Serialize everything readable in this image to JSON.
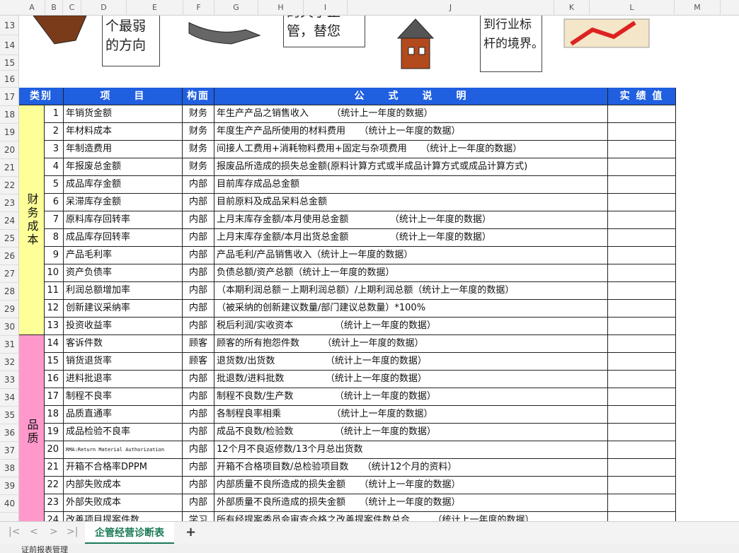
{
  "columns": [
    "A",
    "B",
    "C",
    "D",
    "E",
    "F",
    "G",
    "H",
    "I",
    "J",
    "K",
    "L",
    "M"
  ],
  "rows": [
    "13",
    "14",
    "15",
    "16",
    "17",
    "18",
    "19",
    "20",
    "21",
    "22",
    "23",
    "24",
    "25",
    "26",
    "27",
    "28",
    "29",
    "30",
    "31",
    "32",
    "33",
    "34",
    "35",
    "36",
    "37",
    "38",
    "39",
    "40"
  ],
  "bubbles": {
    "b1": "个最弱\n的方向",
    "b2": "的天子止\n管，替您",
    "b3": "到行业标\n杆的境界。"
  },
  "header": {
    "category": "类别",
    "item": "项　　目",
    "dimension": "构面",
    "formula": "公　　式　　说　　明",
    "actual": "实 绩 值"
  },
  "categories": {
    "finance": "财务成本",
    "quality": "品质"
  },
  "table_rows": [
    {
      "no": "1",
      "item": "年销货金额",
      "dim": "财务",
      "formula": "年生产产品之销售收入　　　（统计上一年度的数据）"
    },
    {
      "no": "2",
      "item": "年材料成本",
      "dim": "财务",
      "formula": "年度生产产品所使用的材料费用　　（统计上一年度的数据）"
    },
    {
      "no": "3",
      "item": "年制造费用",
      "dim": "财务",
      "formula": "间接人工费用+消耗物料费用+固定与杂项费用　　（统计上一年度的数据）"
    },
    {
      "no": "4",
      "item": "年报废总金额",
      "dim": "财务",
      "formula": "报废品所造成的损失总金额(原料计算方式或半成品计算方式或成品计算方式)"
    },
    {
      "no": "5",
      "item": "成品库存金额",
      "dim": "内部",
      "formula": "目前库存成品总金额"
    },
    {
      "no": "6",
      "item": "呆滞库存金额",
      "dim": "内部",
      "formula": "目前原料及成品呆料总金额"
    },
    {
      "no": "7",
      "item": "原料库存回转率",
      "dim": "内部",
      "formula": "上月末库存金额/本月使用总金额　　　　　（统计上一年度的数据）"
    },
    {
      "no": "8",
      "item": "成品库存回转率",
      "dim": "内部",
      "formula": "上月末库存金额/本月出货总金额　　　　　（统计上一年度的数据）"
    },
    {
      "no": "9",
      "item": "产品毛利率",
      "dim": "内部",
      "formula": "产品毛利/产品销售收入（统计上一年度的数据）"
    },
    {
      "no": "10",
      "item": "资产负债率",
      "dim": "内部",
      "formula": "负债总额/资产总额（统计上一年度的数据）"
    },
    {
      "no": "11",
      "item": "利润总额增加率",
      "dim": "内部",
      "formula": "（本期利润总额－上期利润总额）/上期利润总额（统计上一年度的数据）"
    },
    {
      "no": "12",
      "item": "创新建议采纳率",
      "dim": "内部",
      "formula": "（被采纳的创新建议数量/部门建议总数量）*100%"
    },
    {
      "no": "13",
      "item": "投资收益率",
      "dim": "内部",
      "formula": "税后利润/实收资本　　　　　（统计上一年度的数据）"
    },
    {
      "no": "14",
      "item": "客诉件数",
      "dim": "顾客",
      "formula": "顾客的所有抱怨件数　　　（统计上一年度的数据）"
    },
    {
      "no": "15",
      "item": "销货退货率",
      "dim": "顾客",
      "formula": "退货数/出货数　　　　　　（统计上一年度的数据）"
    },
    {
      "no": "16",
      "item": "进料批退率",
      "dim": "内部",
      "formula": "批退数/进料批数　　　　　（统计上一年度的数据）"
    },
    {
      "no": "17",
      "item": "制程不良率",
      "dim": "内部",
      "formula": "制程不良数/生产数　　　　　（统计上一年度的数据）"
    },
    {
      "no": "18",
      "item": "品质直通率",
      "dim": "内部",
      "formula": "各制程良率相乘　　　　　　（统计上一年度的数据）"
    },
    {
      "no": "19",
      "item": "成品检验不良率",
      "dim": "内部",
      "formula": "成品不良数/检验数　　　　　（统计上一年度的数据）"
    },
    {
      "no": "20",
      "item": "RMA:Return Material Authorization",
      "dim": "内部",
      "formula": "12个月不良返修数/13个月总出货数"
    },
    {
      "no": "21",
      "item": "开箱不合格率DPPM",
      "dim": "内部",
      "formula": "开箱不合格项目数/总检验项目数　　（统计12个月的资料）"
    },
    {
      "no": "22",
      "item": "内部失败成本",
      "dim": "内部",
      "formula": "内部质量不良所造成的损失金额　　（统计上一年度的数据）"
    },
    {
      "no": "23",
      "item": "外部失败成本",
      "dim": "内部",
      "formula": "外部质量不良所造成的损失金额　　（统计上一年度的数据）"
    },
    {
      "no": "24",
      "item": "改善项目提案件数",
      "dim": "学习",
      "formula": "所有经提案委员会审查合格之改善提案件数总合　　　（统计上一年度的数据）"
    }
  ],
  "sheet_tab": "企管经营诊断表",
  "nav": {
    "first": "|<",
    "prev": "<",
    "next": ">",
    "last": ">|",
    "add": "+"
  },
  "status": "证前报表管理",
  "colors": {
    "header_blue": "#1f5fe0",
    "finance_yellow": "#ffff99",
    "quality_pink": "#ff99cc",
    "tab_green": "#1a7a57"
  }
}
